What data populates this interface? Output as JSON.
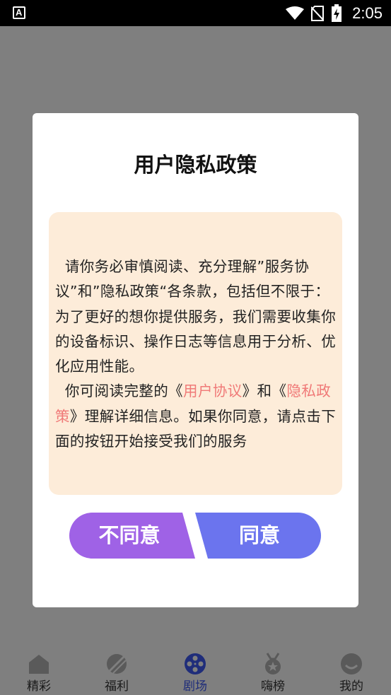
{
  "status_bar": {
    "time": "2:05",
    "left_icon": "A"
  },
  "dialog": {
    "title": "用户隐私政策",
    "paragraph1": "  请你务必审慎阅读、充分理解”服务协议”和”隐私政策“各条款，包括但不限于：为了更好的想你提供服务，我们需要收集你的设备标识、操作日志等信息用于分析、优化应用性能。",
    "paragraph2_prefix": "  你可阅读完整的《",
    "link_user_agreement": "用户协议",
    "paragraph2_mid": "》和《",
    "link_privacy_policy": "隐私政策",
    "paragraph2_suffix": "》理解详细信息。如果你同意，请点击下面的按钮开始接受我们的服务",
    "disagree_label": "不同意",
    "agree_label": "同意"
  },
  "bottom_nav": {
    "items": [
      {
        "label": "精彩",
        "icon": "home-icon"
      },
      {
        "label": "福利",
        "icon": "planet-icon"
      },
      {
        "label": "剧场",
        "icon": "film-reel-icon"
      },
      {
        "label": "嗨榜",
        "icon": "medal-icon"
      },
      {
        "label": "我的",
        "icon": "profile-icon"
      }
    ],
    "active_index": 2
  },
  "colors": {
    "backdrop": "#7f7f7f",
    "policy_box": "#fdecd9",
    "link": "#f07a78",
    "disagree_button": "#9f62e6",
    "agree_button": "#6b74ee",
    "active_nav": "#1f2d7a"
  }
}
